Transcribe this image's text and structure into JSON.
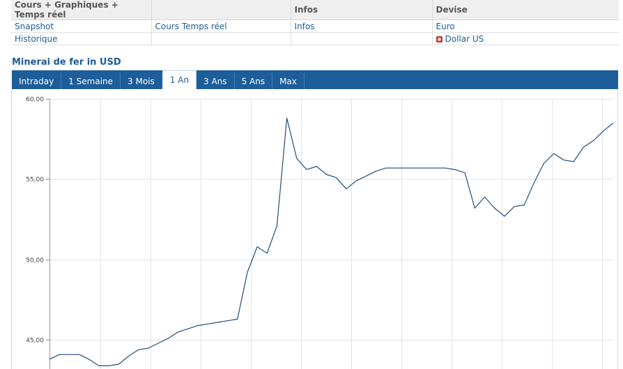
{
  "links_table": {
    "headers": [
      "Cours + Graphiques + Temps réel",
      "",
      "Infos",
      "Devise"
    ],
    "row1": [
      "Snapshot",
      "Cours Temps réel",
      "Infos",
      "Euro"
    ],
    "row2": [
      "Historique",
      "",
      "",
      "Dollar US"
    ]
  },
  "chart_title": "Minerai de fer in USD",
  "tabs": [
    {
      "label": "Intraday",
      "active": false
    },
    {
      "label": "1 Semaine",
      "active": false
    },
    {
      "label": "3 Mois",
      "active": false
    },
    {
      "label": "1 An",
      "active": true
    },
    {
      "label": "3 Ans",
      "active": false
    },
    {
      "label": "5 Ans",
      "active": false
    },
    {
      "label": "Max",
      "active": false
    }
  ],
  "colors": {
    "line": "#1f4e7a",
    "tab_bar": "#1c5d9a",
    "link": "#1f5c99",
    "grid": "#dddddd"
  },
  "chart_data": {
    "type": "line",
    "title": "",
    "xlabel": "",
    "ylabel": "",
    "ylim": [
      43.2,
      60.0
    ],
    "yticks": [
      60.0,
      55.0,
      50.0,
      45.0
    ],
    "ytick_labels": [
      "60,00",
      "55,00",
      "50,00",
      "45,00"
    ],
    "grid": true,
    "series": [
      {
        "values": [
          43.8,
          44.1,
          44.1,
          44.1,
          43.8,
          43.4,
          43.4,
          43.5,
          44.0,
          44.4,
          44.5,
          44.8,
          45.1,
          45.5,
          45.7,
          45.9,
          46.0,
          46.1,
          46.2,
          46.3,
          49.2,
          50.8,
          50.4,
          52.1,
          58.8,
          56.3,
          55.6,
          55.8,
          55.3,
          55.1,
          54.4,
          54.9,
          55.2,
          55.5,
          55.7,
          55.7,
          55.7,
          55.7,
          55.7,
          55.7,
          55.7,
          55.6,
          55.4,
          53.2,
          53.9,
          53.2,
          52.7,
          53.3,
          53.4,
          54.8,
          56.0,
          56.6,
          56.2,
          56.1,
          57.0,
          57.4,
          58.0,
          58.5
        ]
      }
    ]
  }
}
